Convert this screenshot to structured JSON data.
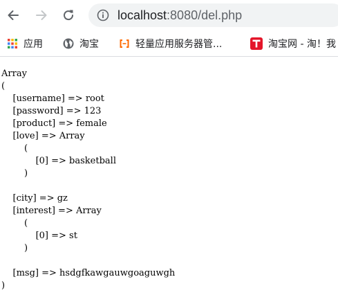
{
  "toolbar": {
    "url_host": "localhost",
    "url_path": ":8080/del.php"
  },
  "bookmarks": [
    {
      "label": "应用",
      "icon": "apps-grid-icon"
    },
    {
      "label": "淘宝",
      "icon": "globe-icon"
    },
    {
      "label": "轻量应用服务器管...",
      "icon": "aliyun-icon"
    },
    {
      "label": "淘宝网 - 淘！我",
      "icon": "taobao-t-icon"
    }
  ],
  "output": {
    "lines": [
      "Array",
      "(",
      "    [username] => root",
      "    [password] => 123",
      "    [product] => female",
      "    [love] => Array",
      "        (",
      "            [0] => basketball",
      "        )",
      "",
      "    [city] => gz",
      "    [interest] => Array",
      "        (",
      "            [0] => st",
      "        )",
      "",
      "    [msg] => hsdgfkawgauwgoaguwgh",
      ")"
    ]
  }
}
